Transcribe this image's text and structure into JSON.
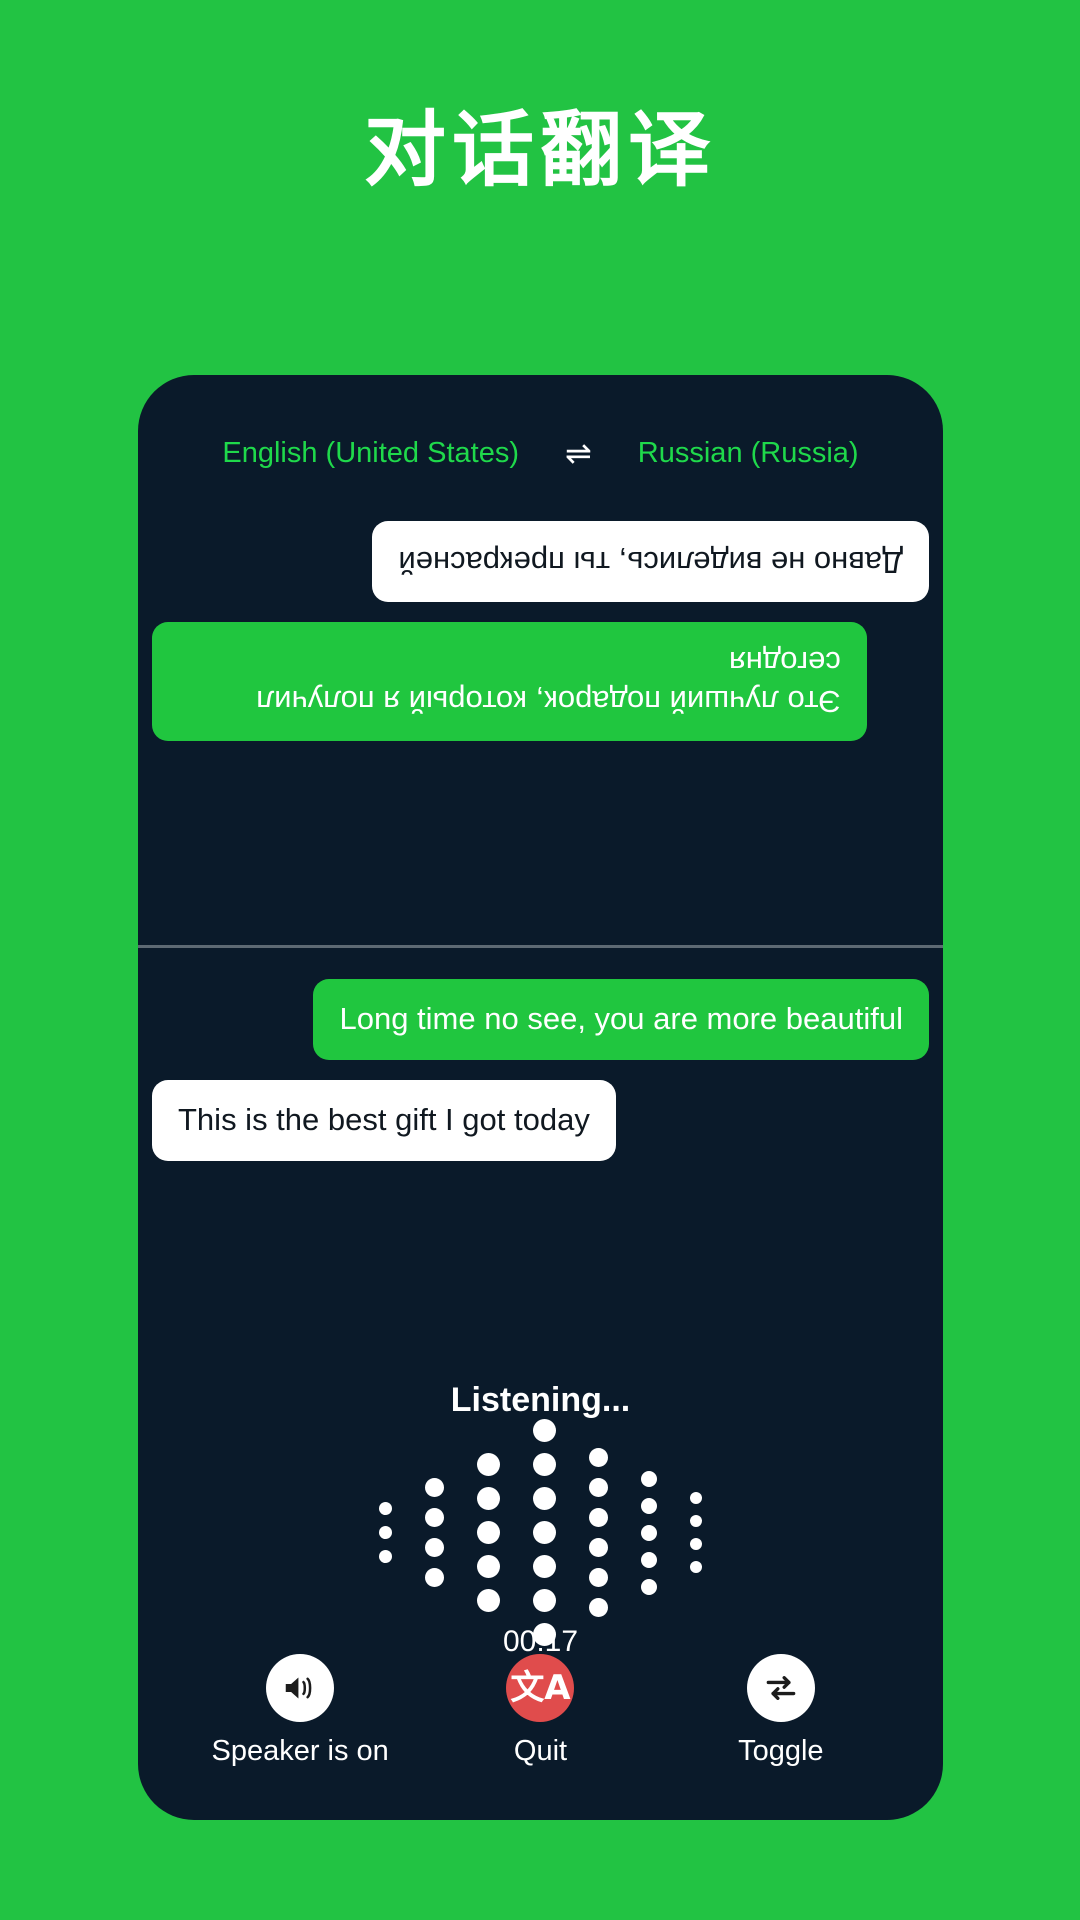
{
  "theme": {
    "background": "#22c343",
    "panel": "#0a1a2a",
    "accent_green": "#20c63f",
    "lang_green": "#1fd94b",
    "quit_red": "#e04c4c",
    "bubble_white": "#ffffff",
    "divider": "#5d6973"
  },
  "headline": "对话翻译",
  "languages": {
    "source": "English (United States)",
    "swap_icon": "⇌",
    "target": "Russian (Russia)"
  },
  "conversation": {
    "top_pane": {
      "messages": [
        {
          "text": "Это лучший подарок, который я получил сегодня",
          "style": "green",
          "align": "right"
        },
        {
          "text": "Давно не виделись, ты прекрасней",
          "style": "white",
          "align": "left"
        }
      ]
    },
    "bottom_pane": {
      "messages": [
        {
          "text": "Long time no see, you are more beautiful",
          "style": "green",
          "align": "right"
        },
        {
          "text": "This is the best gift I got today",
          "style": "white",
          "align": "left"
        }
      ]
    }
  },
  "status": {
    "listening_label": "Listening...",
    "timer": "00:17"
  },
  "waveform": {
    "columns": [
      {
        "count": 3,
        "size": 13
      },
      {
        "count": 4,
        "size": 19
      },
      {
        "count": 5,
        "size": 23
      },
      {
        "count": 7,
        "size": 23
      },
      {
        "count": 6,
        "size": 19
      },
      {
        "count": 5,
        "size": 16
      },
      {
        "count": 4,
        "size": 12
      }
    ]
  },
  "actions": [
    {
      "label": "Speaker is on",
      "icon": "speaker-on-icon",
      "circle": "white"
    },
    {
      "label": "Quit",
      "icon": "translate-icon",
      "circle": "red"
    },
    {
      "label": "Toggle",
      "icon": "swap-arrows-icon",
      "circle": "white"
    }
  ]
}
